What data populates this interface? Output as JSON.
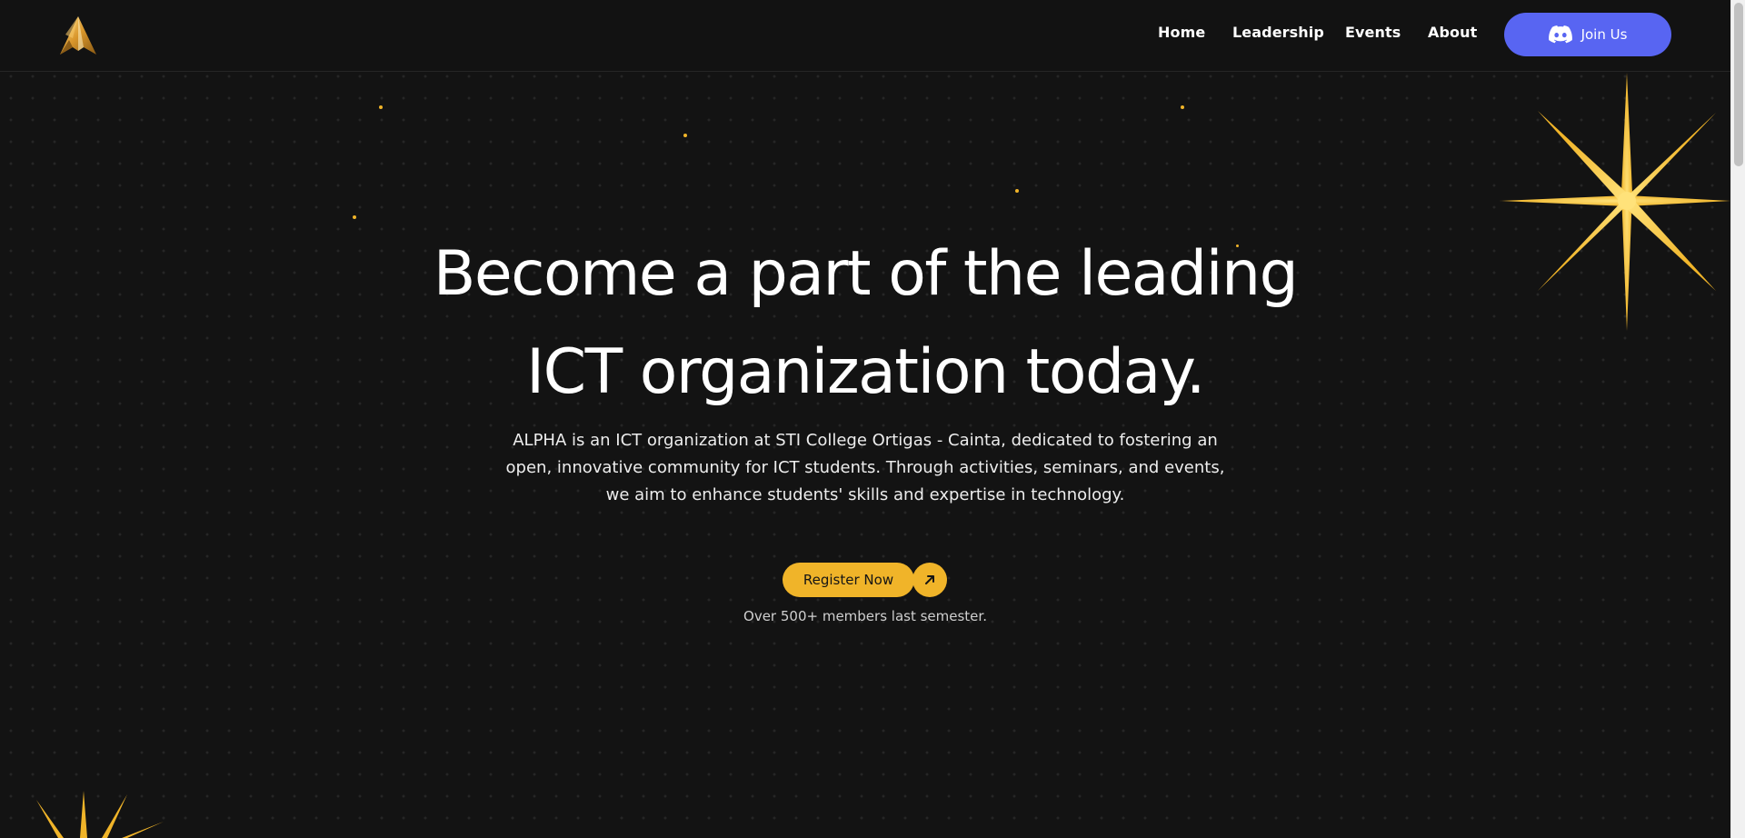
{
  "colors": {
    "background": "#131313",
    "accent_gold": "#f0b429",
    "discord_blue": "#5865f2",
    "text": "#ffffff"
  },
  "navbar": {
    "logo_icon": "alpha-logo-icon",
    "links": {
      "home": "Home",
      "leadership": "Leadership",
      "events": "Events",
      "about": "About"
    },
    "join_button": {
      "label": "Join Us",
      "icon": "discord-icon"
    }
  },
  "hero": {
    "title_line_1": "Become a part of the leading",
    "title_line_2": "ICT organization today.",
    "description": "ALPHA is an ICT organization at STI College Ortigas - Cainta, dedicated to fostering an open, innovative community for ICT students. Through activities, seminars, and events, we aim to enhance students' skills and expertise in technology.",
    "cta": {
      "label": "Register Now",
      "icon": "arrow-up-right-icon"
    },
    "members_note": "Over 500+ members last semester."
  },
  "decorations": {
    "large_star_icon": "sparkle-star-icon",
    "small_star_icon": "sparkle-star-icon"
  }
}
